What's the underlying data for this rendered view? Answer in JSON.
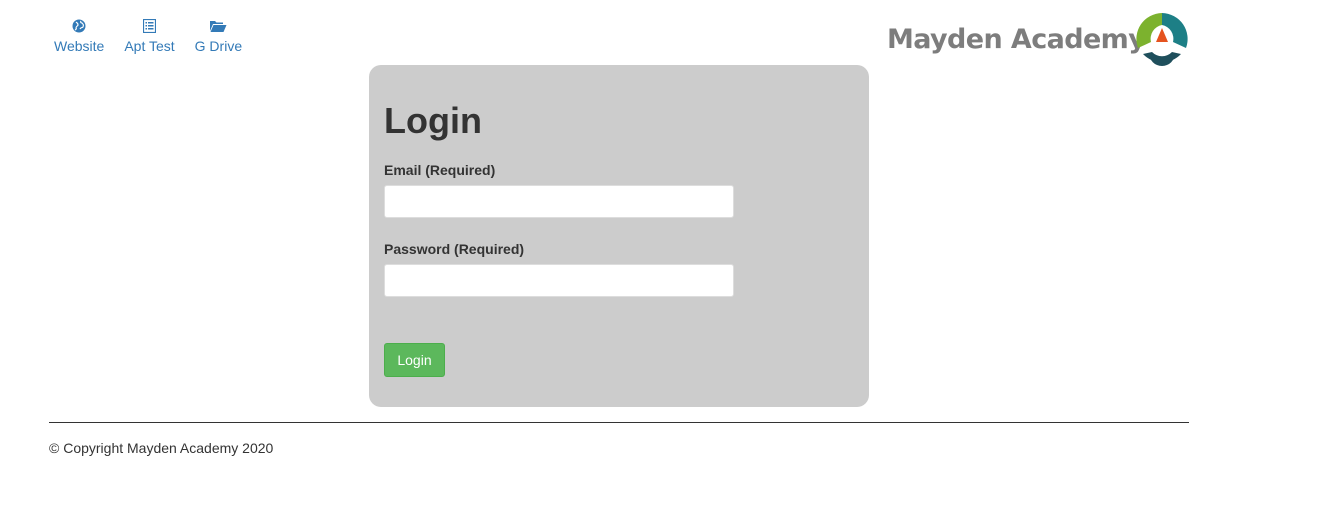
{
  "nav": {
    "items": [
      {
        "label": "Website",
        "icon": "globe-icon"
      },
      {
        "label": "Apt Test",
        "icon": "list-alt-icon"
      },
      {
        "label": "G Drive",
        "icon": "folder-open-icon"
      }
    ]
  },
  "logo": {
    "text": "Mayden Academy",
    "colors": {
      "text": "#7d7d7d",
      "green": "#7cb22e",
      "teal": "#1d7f86",
      "dark": "#1f4f5c",
      "orange": "#e5531f"
    }
  },
  "login": {
    "title": "Login",
    "email_label": "Email (Required)",
    "email_value": "",
    "password_label": "Password (Required)",
    "password_value": "",
    "button_label": "Login"
  },
  "footer": {
    "copyright": "© Copyright Mayden Academy 2020"
  },
  "colors": {
    "link": "#337ab7",
    "panel": "#cccccc",
    "button": "#5cb85c"
  }
}
